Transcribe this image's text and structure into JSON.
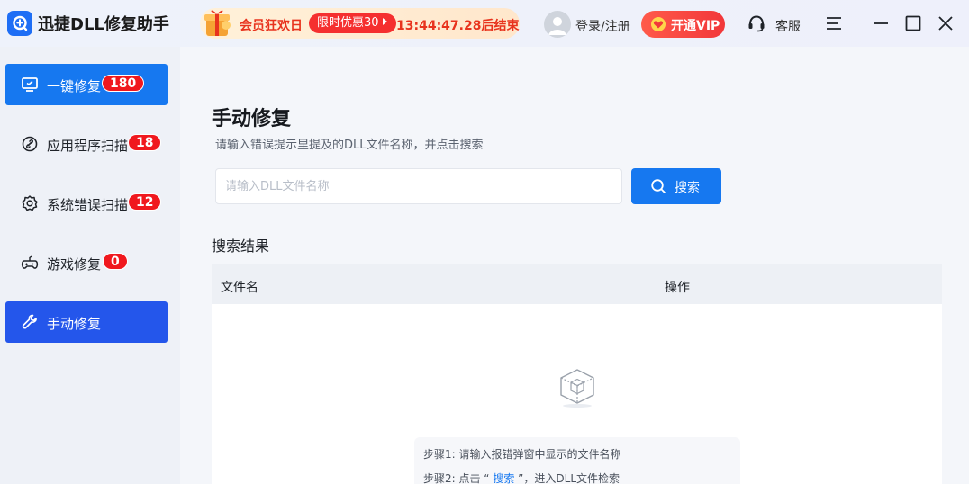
{
  "app": {
    "title": "迅捷DLL修复助手"
  },
  "promo": {
    "title": "会员狂欢日",
    "pill": "限时优惠30",
    "countdown": "13:44:47.28后结束"
  },
  "header": {
    "login_label": "登录/注册",
    "vip_label": "开通VIP",
    "service_label": "客服"
  },
  "sidebar": {
    "items": [
      {
        "label": "一键修复",
        "badge": "180"
      },
      {
        "label": "应用程序扫描",
        "badge": "18"
      },
      {
        "label": "系统错误扫描",
        "badge": "12"
      },
      {
        "label": "游戏修复",
        "badge": "0"
      },
      {
        "label": "手动修复",
        "badge": ""
      }
    ]
  },
  "main": {
    "title": "手动修复",
    "subtitle": "请输入错误提示里提及的DLL文件名称，并点击搜索",
    "search_placeholder": "请输入DLL文件名称",
    "search_value": "",
    "search_button": "搜索",
    "results_heading": "搜索结果",
    "columns": [
      "文件名",
      "操作"
    ],
    "steps": {
      "step1": "步骤1: 请输入报错弹窗中显示的文件名称",
      "step2_prefix": "步骤2: 点击 “ ",
      "step2_link": "搜索",
      "step2_suffix": " ”，进入DLL文件检索"
    }
  },
  "colors": {
    "primary": "#1678f0",
    "manual_active": "#2456eb",
    "badge_red": "#f0181e",
    "promo_red": "#e8331d"
  }
}
